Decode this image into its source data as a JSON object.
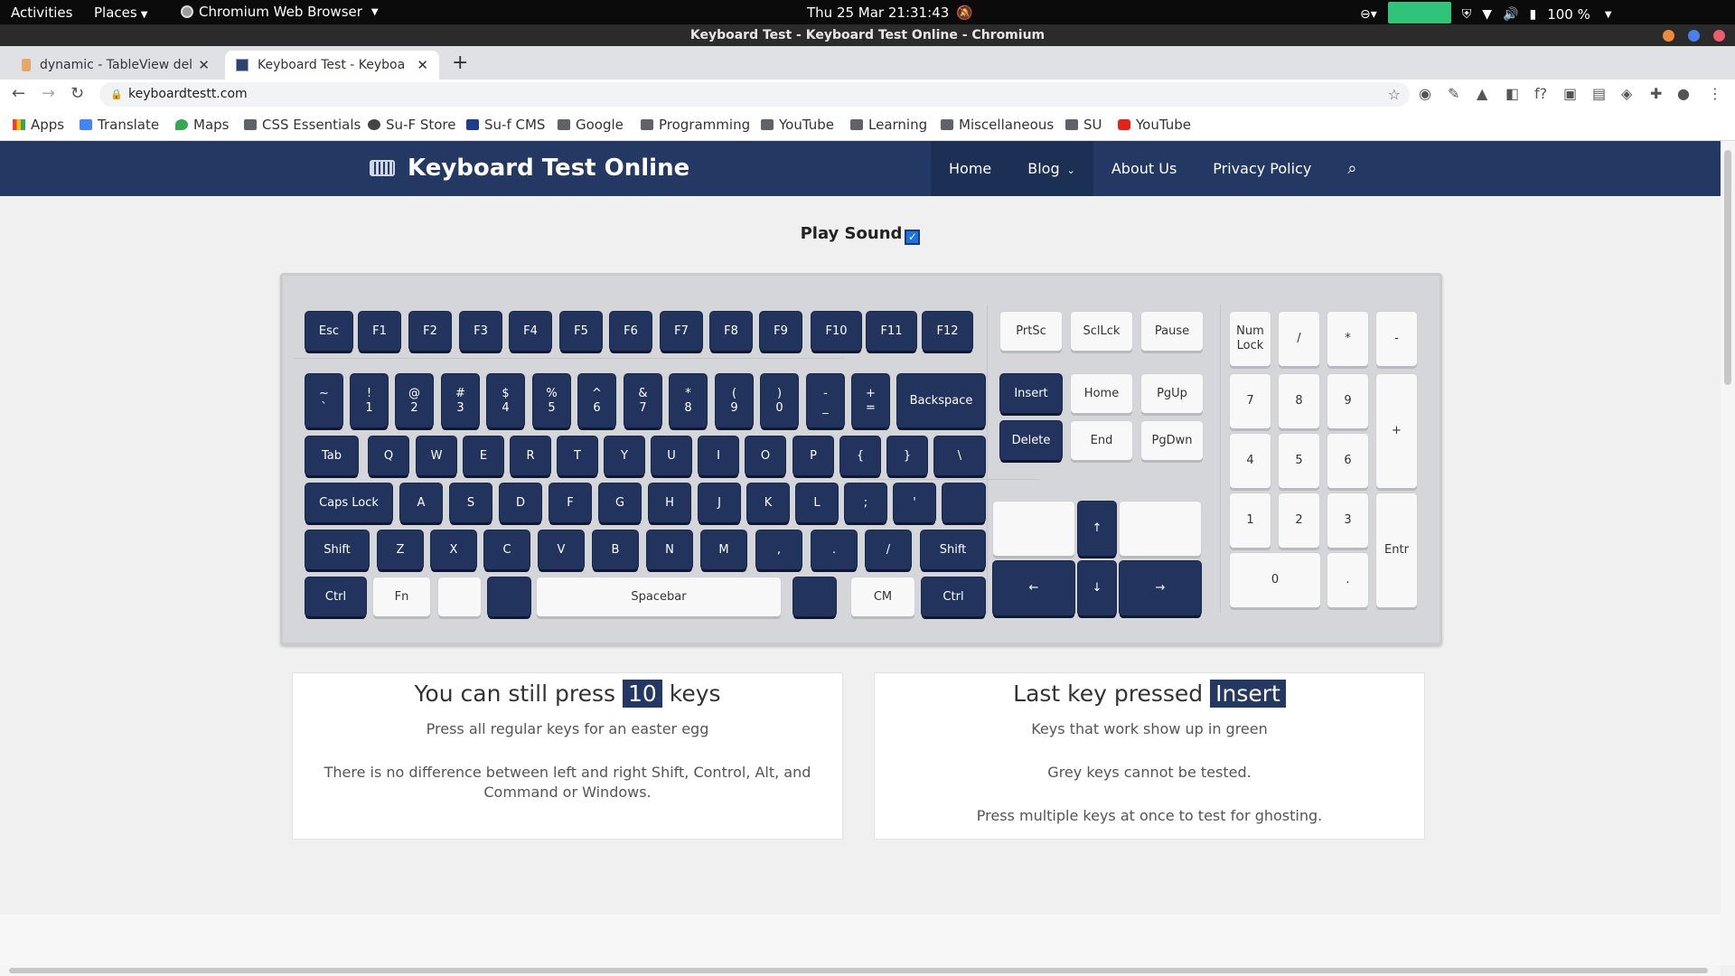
{
  "system_bar": {
    "activities": "Activities",
    "places": "Places",
    "app_name": "Chromium Web Browser",
    "clock": "Thu 25 Mar  21:31:43",
    "battery": "100 %"
  },
  "window": {
    "title": "Keyboard Test - Keyboard Test Online - Chromium"
  },
  "tabs": [
    {
      "title": "dynamic - TableView dele"
    },
    {
      "title": "Keyboard Test - Keyboa"
    }
  ],
  "address_bar": {
    "url": "keyboardtestt.com"
  },
  "bookmarks": [
    "Apps",
    "Translate",
    "Maps",
    "CSS Essentials",
    "Su-F Store",
    "Su-f CMS",
    "Google",
    "Programming",
    "YouTube",
    "Learning",
    "Miscellaneous",
    "SU",
    "YouTube"
  ],
  "site": {
    "logo": "Keyboard Test Online",
    "nav": [
      "Home",
      "Blog",
      "About Us",
      "Privacy Policy"
    ],
    "play_sound_label": "Play Sound",
    "play_sound_checked": true,
    "colors": {
      "header": "#233862",
      "dark_key": "#22345d",
      "light_key": "#f8f8f8"
    }
  },
  "keyboard": {
    "function_row": [
      "Esc",
      "F1",
      "F2",
      "F3",
      "F4",
      "F5",
      "F6",
      "F7",
      "F8",
      "F9",
      "F10",
      "F11",
      "F12"
    ],
    "number_row": [
      "~\n`",
      "!\n1",
      "@\n2",
      "#\n3",
      "$\n4",
      "%\n5",
      "^\n6",
      "&\n7",
      "*\n8",
      "(\n9",
      ")\n0",
      "-\n_",
      "+\n=",
      "Backspace"
    ],
    "qwerty_row": [
      "Tab",
      "Q",
      "W",
      "E",
      "R",
      "T",
      "Y",
      "U",
      "I",
      "O",
      "P",
      "{",
      "}",
      "\\"
    ],
    "home_row": [
      "Caps Lock",
      "A",
      "S",
      "D",
      "F",
      "G",
      "H",
      "J",
      "K",
      "L",
      ";",
      "'",
      ""
    ],
    "shift_row": [
      "Shift",
      "Z",
      "X",
      "C",
      "V",
      "B",
      "N",
      "M",
      ",",
      ".",
      "/",
      "Shift"
    ],
    "bottom_row": [
      "Ctrl",
      "Fn",
      "",
      "",
      "Spacebar",
      "",
      "CM",
      "Ctrl"
    ],
    "system_keys": [
      "PrtSc",
      "SclLck",
      "Pause"
    ],
    "nav_keys": [
      "Insert",
      "Home",
      "PgUp",
      "Delete",
      "End",
      "PgDwn"
    ],
    "arrows": {
      "up": "↑",
      "left": "←",
      "down": "↓",
      "right": "→"
    },
    "numpad": [
      "Num\nLock",
      "/",
      "*",
      "-",
      "7",
      "8",
      "9",
      "+",
      "4",
      "5",
      "6",
      "1",
      "2",
      "3",
      "Entr",
      "0",
      "."
    ]
  },
  "stats_left": {
    "before": "You can still press",
    "count": "10",
    "after": "keys",
    "line1": "Press all regular keys for an easter egg",
    "line2": "There is no difference between left and right Shift, Control, Alt, and Command or Windows."
  },
  "stats_right": {
    "before": "Last key pressed",
    "key": "Insert",
    "line1": "Keys that work show up in green",
    "line2": "Grey keys cannot be tested.",
    "line3": "Press multiple keys at once to test for ghosting."
  }
}
